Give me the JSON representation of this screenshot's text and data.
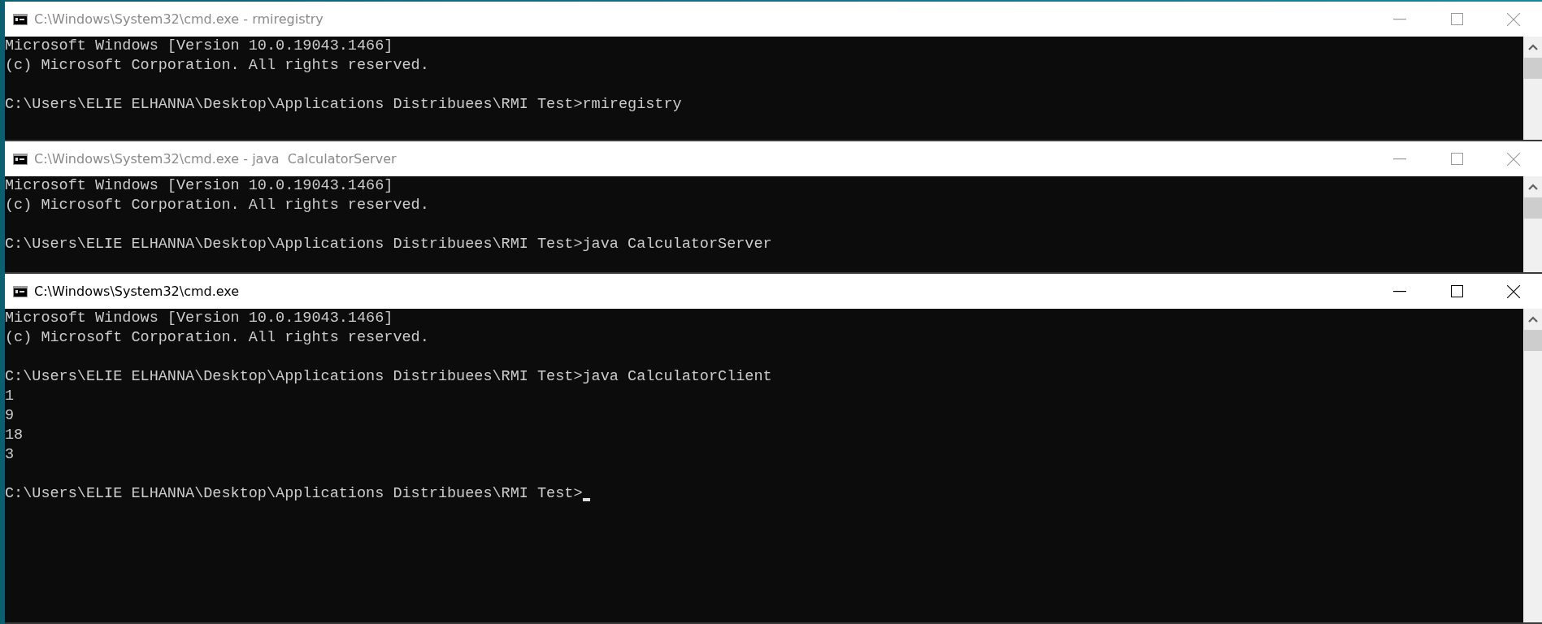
{
  "windows": [
    {
      "title": "C:\\Windows\\System32\\cmd.exe - rmiregistry",
      "active": false,
      "cursor": false,
      "blocks": [
        [
          "Microsoft Windows [Version 10.0.19043.1466]",
          "(c) Microsoft Corporation. All rights reserved."
        ],
        [
          "C:\\Users\\ELIE ELHANNA\\Desktop\\Applications Distribuees\\RMI Test>rmiregistry"
        ]
      ]
    },
    {
      "title": "C:\\Windows\\System32\\cmd.exe - java  CalculatorServer",
      "active": false,
      "cursor": false,
      "blocks": [
        [
          "Microsoft Windows [Version 10.0.19043.1466]",
          "(c) Microsoft Corporation. All rights reserved."
        ],
        [
          "C:\\Users\\ELIE ELHANNA\\Desktop\\Applications Distribuees\\RMI Test>java CalculatorServer"
        ]
      ]
    },
    {
      "title": "C:\\Windows\\System32\\cmd.exe",
      "active": true,
      "cursor": true,
      "blocks": [
        [
          "Microsoft Windows [Version 10.0.19043.1466]",
          "(c) Microsoft Corporation. All rights reserved."
        ],
        [
          "C:\\Users\\ELIE ELHANNA\\Desktop\\Applications Distribuees\\RMI Test>java CalculatorClient",
          "1",
          "9",
          "18",
          "3"
        ],
        [
          "C:\\Users\\ELIE ELHANNA\\Desktop\\Applications Distribuees\\RMI Test>"
        ]
      ]
    }
  ]
}
